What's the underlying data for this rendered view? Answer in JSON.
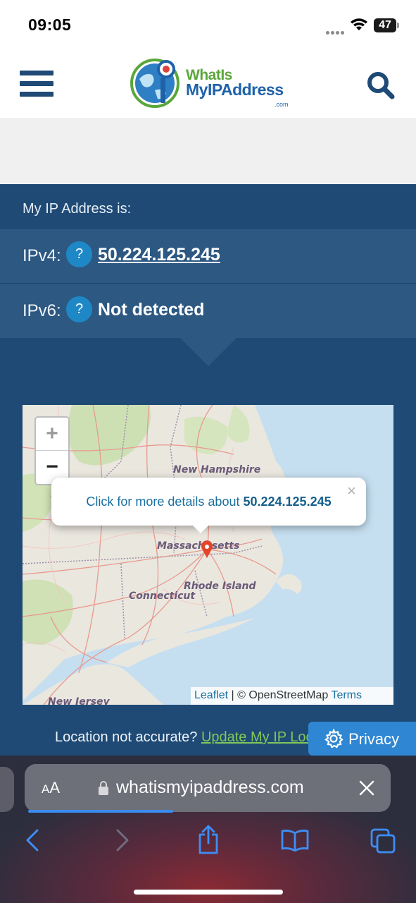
{
  "status_bar": {
    "time": "09:05",
    "battery": "47"
  },
  "header": {
    "logo_line1": "WhatIs",
    "logo_line2": "MyIPAddress",
    "logo_com": ".com"
  },
  "ip_section": {
    "heading": "My IP Address is:",
    "ipv4_label": "IPv4:",
    "ipv4_value": "50.224.125.245",
    "ipv6_label": "IPv6:",
    "ipv6_value": "Not detected",
    "help_glyph": "?"
  },
  "map": {
    "zoom_in": "+",
    "zoom_out": "−",
    "labels": {
      "new_hampshire": "New Hampshire",
      "massachusetts": "Massachusetts",
      "rhode_island": "Rhode Island",
      "connecticut": "Connecticut",
      "new_jersey": "New Jersey"
    },
    "popup_text": "Click for more details about",
    "popup_ip": "50.224.125.245",
    "popup_close": "×",
    "attribution_leaflet": "Leaflet",
    "attribution_sep": " | © OpenStreetMap ",
    "attribution_terms": "Terms"
  },
  "location": {
    "note": "Location not accurate?",
    "link": "Update My IP Location"
  },
  "privacy": {
    "label": "Privacy"
  },
  "browser": {
    "aa_small": "A",
    "aa_large": "A",
    "url": "whatismyipaddress.com",
    "progress_fraction": 0.4
  },
  "colors": {
    "brand_navy": "#1f4a75",
    "row_blue": "#2d5882",
    "help_blue": "#1e88c7",
    "privacy_blue": "#2f86d2",
    "link_green": "#7fc85a",
    "pin_red": "#e2452a"
  }
}
